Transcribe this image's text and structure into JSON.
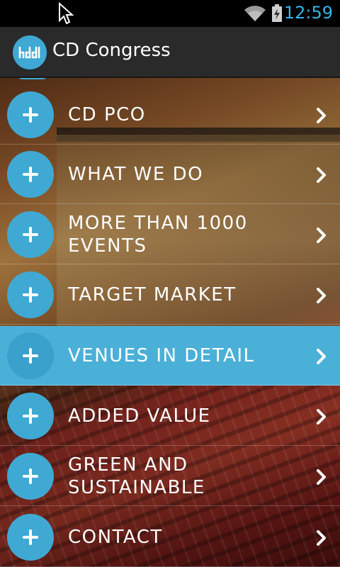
{
  "status_bar": {
    "time": "12:59",
    "icons": [
      "cursor-icon",
      "wifi-icon",
      "battery-charging-icon"
    ],
    "accent": "#33b5e5"
  },
  "action_bar": {
    "title": "CD Congress",
    "logo_icon": "cd-logo-icon"
  },
  "menu": {
    "selected_index": 4,
    "items": [
      {
        "label": "CD PCO"
      },
      {
        "label": "WHAT WE DO"
      },
      {
        "label": "MORE THAN 1000 EVENTS"
      },
      {
        "label": "TARGET MARKET"
      },
      {
        "label": "VENUES IN DETAIL"
      },
      {
        "label": "ADDED VALUE"
      },
      {
        "label": "GREEN AND SUSTAINABLE"
      },
      {
        "label": "CONTACT"
      }
    ],
    "item_icon": "plus-icon",
    "arrow_icon": "chevron-right-icon"
  },
  "colors": {
    "accent_blue": "#3fa9d4",
    "selected_bg": "#4ab0d8",
    "action_bar_bg": "#2a2a2a"
  }
}
